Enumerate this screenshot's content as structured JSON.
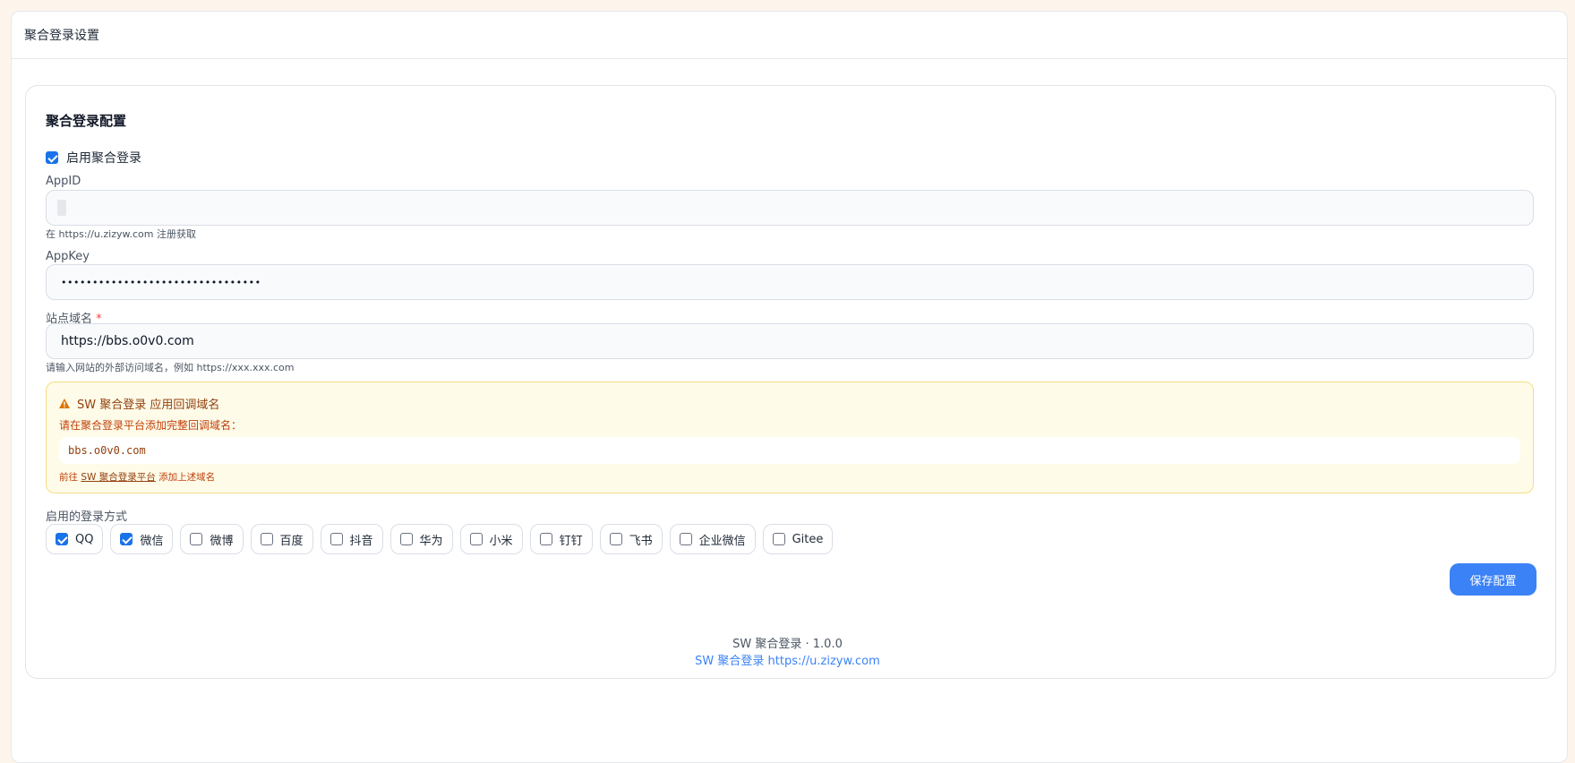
{
  "panel": {
    "header_title": "聚合登录设置"
  },
  "config": {
    "title": "聚合登录配置",
    "enable_label": "启用聚合登录",
    "enable_checked": true,
    "appid": {
      "label": "AppID",
      "value": "",
      "help": "在 https://u.zizyw.com 注册获取"
    },
    "appkey": {
      "label": "AppKey",
      "value": "••••••••••••••••••••••••••••••••"
    },
    "domain": {
      "label": "站点域名",
      "required_mark": "*",
      "value": "https://bbs.o0v0.com",
      "help": "请输入网站的外部访问域名，例如 https://xxx.xxx.com"
    }
  },
  "callback_notice": {
    "title": "SW 聚合登录 应用回调域名",
    "subtitle": "请在聚合登录平台添加完整回调域名：",
    "code": "bbs.o0v0.com",
    "foot_prefix": "前往 ",
    "foot_link": "SW 聚合登录平台",
    "foot_suffix": " 添加上述域名",
    "icon": "warning-triangle-icon",
    "color": "#92400e"
  },
  "methods": {
    "label": "启用的登录方式",
    "items": [
      {
        "label": "QQ",
        "checked": true
      },
      {
        "label": "微信",
        "checked": true
      },
      {
        "label": "微博",
        "checked": false
      },
      {
        "label": "百度",
        "checked": false
      },
      {
        "label": "抖音",
        "checked": false
      },
      {
        "label": "华为",
        "checked": false
      },
      {
        "label": "小米",
        "checked": false
      },
      {
        "label": "钉钉",
        "checked": false
      },
      {
        "label": "飞书",
        "checked": false
      },
      {
        "label": "企业微信",
        "checked": false
      },
      {
        "label": "Gitee",
        "checked": false
      }
    ]
  },
  "save_button": {
    "label": "保存配置",
    "color": "#3b82f6"
  },
  "footer": {
    "version": "SW 聚合登录 · 1.0.0",
    "link": "SW 聚合登录 https://u.zizyw.com"
  }
}
